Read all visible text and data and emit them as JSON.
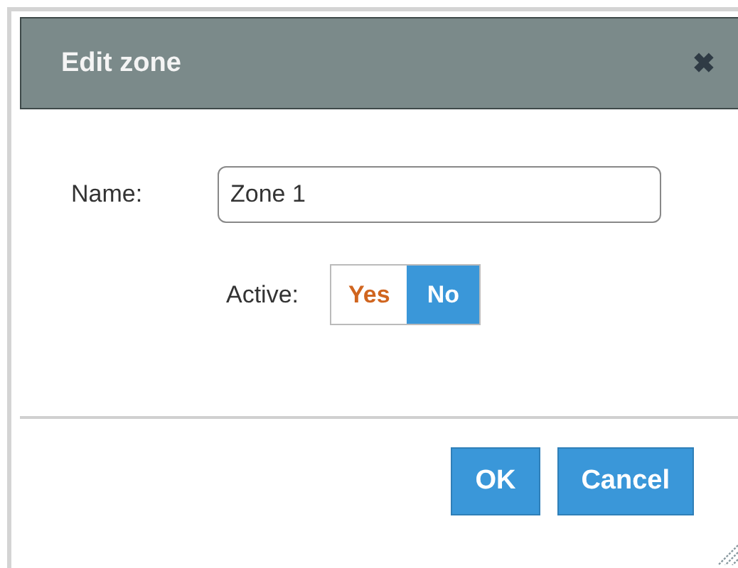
{
  "dialog": {
    "title": "Edit zone",
    "close": "✖"
  },
  "name_field": {
    "label": "Name:",
    "value": "Zone 1"
  },
  "active_field": {
    "label": "Active:",
    "options": [
      {
        "label": "Yes",
        "selected": false
      },
      {
        "label": "No",
        "selected": true
      }
    ]
  },
  "buttons": [
    "OK",
    "Cancel"
  ]
}
